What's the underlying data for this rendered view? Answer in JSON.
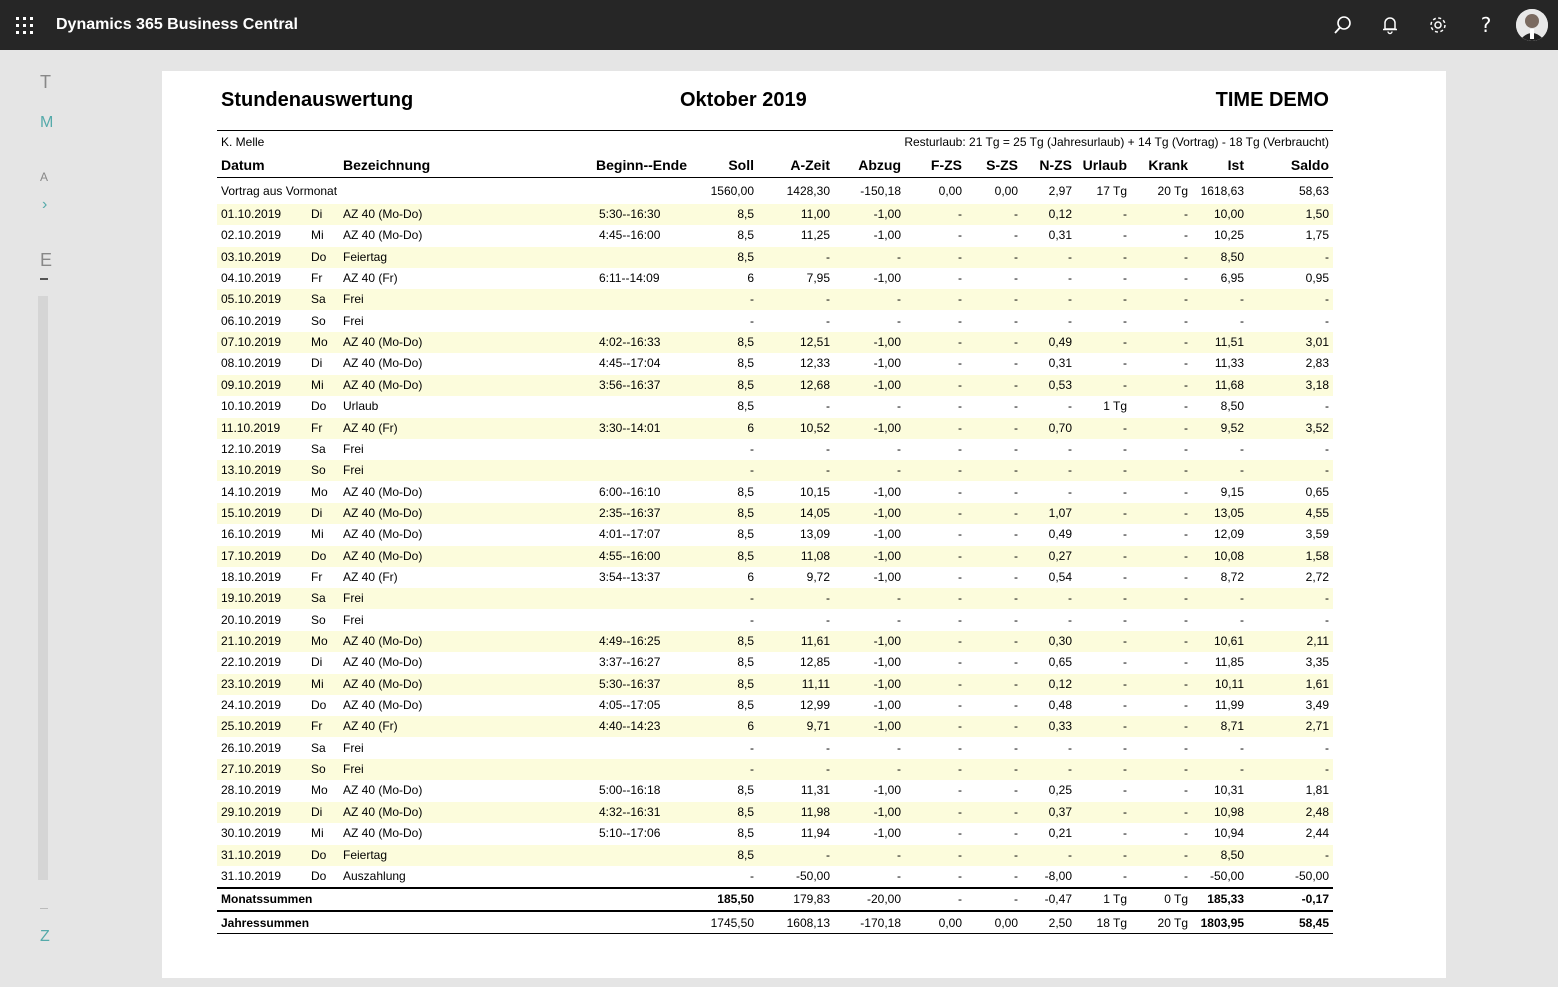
{
  "app": {
    "title": "Dynamics 365 Business Central"
  },
  "topbar_icons": [
    "waffle-icon",
    "search-icon",
    "bell-icon",
    "gear-icon",
    "help-icon",
    "avatar"
  ],
  "background_letters": {
    "t": "T",
    "m": "M",
    "a": "A",
    "arrow": "›",
    "e": "E",
    "z": "Z"
  },
  "report": {
    "title": "Stundenauswertung",
    "period": "Oktober 2019",
    "company": "TIME DEMO",
    "employee": "K. Melle",
    "vacation_note": "Resturlaub: 21 Tg = 25 Tg (Jahresurlaub) + 14 Tg (Vortrag) - 18 Tg (Verbraucht)",
    "headers": {
      "datum": "Datum",
      "bezeichnung": "Bezeichnung",
      "beginn_ende": "Beginn--Ende",
      "soll": "Soll",
      "azeit": "A-Zeit",
      "abzug": "Abzug",
      "fzs": "F-ZS",
      "szs": "S-ZS",
      "nzs": "N-ZS",
      "urlaub": "Urlaub",
      "krank": "Krank",
      "ist": "Ist",
      "saldo": "Saldo"
    },
    "carry": {
      "label": "Vortrag aus Vormonat",
      "soll": "1560,00",
      "azeit": "1428,30",
      "abzug": "-150,18",
      "fzs": "0,00",
      "szs": "0,00",
      "nzs": "2,97",
      "urlaub": "17 Tg",
      "krank": "20 Tg",
      "ist": "1618,63",
      "saldo": "58,63"
    },
    "rows": [
      [
        "01.10.2019",
        "Di",
        "AZ 40 (Mo-Do)",
        "5:30--16:30",
        "8,5",
        "11,00",
        "-1,00",
        "-",
        "-",
        "0,12",
        "-",
        "-",
        "10,00",
        "1,50"
      ],
      [
        "02.10.2019",
        "Mi",
        "AZ 40 (Mo-Do)",
        "4:45--16:00",
        "8,5",
        "11,25",
        "-1,00",
        "-",
        "-",
        "0,31",
        "-",
        "-",
        "10,25",
        "1,75"
      ],
      [
        "03.10.2019",
        "Do",
        "Feiertag",
        "",
        "8,5",
        "-",
        "-",
        "-",
        "-",
        "-",
        "-",
        "-",
        "8,50",
        "-"
      ],
      [
        "04.10.2019",
        "Fr",
        "AZ 40 (Fr)",
        "6:11--14:09",
        "6",
        "7,95",
        "-1,00",
        "-",
        "-",
        "-",
        "-",
        "-",
        "6,95",
        "0,95"
      ],
      [
        "05.10.2019",
        "Sa",
        "Frei",
        "",
        "-",
        "-",
        "-",
        "-",
        "-",
        "-",
        "-",
        "-",
        "-",
        "-"
      ],
      [
        "06.10.2019",
        "So",
        "Frei",
        "",
        "-",
        "-",
        "-",
        "-",
        "-",
        "-",
        "-",
        "-",
        "-",
        "-"
      ],
      [
        "07.10.2019",
        "Mo",
        "AZ 40 (Mo-Do)",
        "4:02--16:33",
        "8,5",
        "12,51",
        "-1,00",
        "-",
        "-",
        "0,49",
        "-",
        "-",
        "11,51",
        "3,01"
      ],
      [
        "08.10.2019",
        "Di",
        "AZ 40 (Mo-Do)",
        "4:45--17:04",
        "8,5",
        "12,33",
        "-1,00",
        "-",
        "-",
        "0,31",
        "-",
        "-",
        "11,33",
        "2,83"
      ],
      [
        "09.10.2019",
        "Mi",
        "AZ 40 (Mo-Do)",
        "3:56--16:37",
        "8,5",
        "12,68",
        "-1,00",
        "-",
        "-",
        "0,53",
        "-",
        "-",
        "11,68",
        "3,18"
      ],
      [
        "10.10.2019",
        "Do",
        "Urlaub",
        "",
        "8,5",
        "-",
        "-",
        "-",
        "-",
        "-",
        "1 Tg",
        "-",
        "8,50",
        "-"
      ],
      [
        "11.10.2019",
        "Fr",
        "AZ 40 (Fr)",
        "3:30--14:01",
        "6",
        "10,52",
        "-1,00",
        "-",
        "-",
        "0,70",
        "-",
        "-",
        "9,52",
        "3,52"
      ],
      [
        "12.10.2019",
        "Sa",
        "Frei",
        "",
        "-",
        "-",
        "-",
        "-",
        "-",
        "-",
        "-",
        "-",
        "-",
        "-"
      ],
      [
        "13.10.2019",
        "So",
        "Frei",
        "",
        "-",
        "-",
        "-",
        "-",
        "-",
        "-",
        "-",
        "-",
        "-",
        "-"
      ],
      [
        "14.10.2019",
        "Mo",
        "AZ 40 (Mo-Do)",
        "6:00--16:10",
        "8,5",
        "10,15",
        "-1,00",
        "-",
        "-",
        "-",
        "-",
        "-",
        "9,15",
        "0,65"
      ],
      [
        "15.10.2019",
        "Di",
        "AZ 40 (Mo-Do)",
        "2:35--16:37",
        "8,5",
        "14,05",
        "-1,00",
        "-",
        "-",
        "1,07",
        "-",
        "-",
        "13,05",
        "4,55"
      ],
      [
        "16.10.2019",
        "Mi",
        "AZ 40 (Mo-Do)",
        "4:01--17:07",
        "8,5",
        "13,09",
        "-1,00",
        "-",
        "-",
        "0,49",
        "-",
        "-",
        "12,09",
        "3,59"
      ],
      [
        "17.10.2019",
        "Do",
        "AZ 40 (Mo-Do)",
        "4:55--16:00",
        "8,5",
        "11,08",
        "-1,00",
        "-",
        "-",
        "0,27",
        "-",
        "-",
        "10,08",
        "1,58"
      ],
      [
        "18.10.2019",
        "Fr",
        "AZ 40 (Fr)",
        "3:54--13:37",
        "6",
        "9,72",
        "-1,00",
        "-",
        "-",
        "0,54",
        "-",
        "-",
        "8,72",
        "2,72"
      ],
      [
        "19.10.2019",
        "Sa",
        "Frei",
        "",
        "-",
        "-",
        "-",
        "-",
        "-",
        "-",
        "-",
        "-",
        "-",
        "-"
      ],
      [
        "20.10.2019",
        "So",
        "Frei",
        "",
        "-",
        "-",
        "-",
        "-",
        "-",
        "-",
        "-",
        "-",
        "-",
        "-"
      ],
      [
        "21.10.2019",
        "Mo",
        "AZ 40 (Mo-Do)",
        "4:49--16:25",
        "8,5",
        "11,61",
        "-1,00",
        "-",
        "-",
        "0,30",
        "-",
        "-",
        "10,61",
        "2,11"
      ],
      [
        "22.10.2019",
        "Di",
        "AZ 40 (Mo-Do)",
        "3:37--16:27",
        "8,5",
        "12,85",
        "-1,00",
        "-",
        "-",
        "0,65",
        "-",
        "-",
        "11,85",
        "3,35"
      ],
      [
        "23.10.2019",
        "Mi",
        "AZ 40 (Mo-Do)",
        "5:30--16:37",
        "8,5",
        "11,11",
        "-1,00",
        "-",
        "-",
        "0,12",
        "-",
        "-",
        "10,11",
        "1,61"
      ],
      [
        "24.10.2019",
        "Do",
        "AZ 40 (Mo-Do)",
        "4:05--17:05",
        "8,5",
        "12,99",
        "-1,00",
        "-",
        "-",
        "0,48",
        "-",
        "-",
        "11,99",
        "3,49"
      ],
      [
        "25.10.2019",
        "Fr",
        "AZ 40 (Fr)",
        "4:40--14:23",
        "6",
        "9,71",
        "-1,00",
        "-",
        "-",
        "0,33",
        "-",
        "-",
        "8,71",
        "2,71"
      ],
      [
        "26.10.2019",
        "Sa",
        "Frei",
        "",
        "-",
        "-",
        "-",
        "-",
        "-",
        "-",
        "-",
        "-",
        "-",
        "-"
      ],
      [
        "27.10.2019",
        "So",
        "Frei",
        "",
        "-",
        "-",
        "-",
        "-",
        "-",
        "-",
        "-",
        "-",
        "-",
        "-"
      ],
      [
        "28.10.2019",
        "Mo",
        "AZ 40 (Mo-Do)",
        "5:00--16:18",
        "8,5",
        "11,31",
        "-1,00",
        "-",
        "-",
        "0,25",
        "-",
        "-",
        "10,31",
        "1,81"
      ],
      [
        "29.10.2019",
        "Di",
        "AZ 40 (Mo-Do)",
        "4:32--16:31",
        "8,5",
        "11,98",
        "-1,00",
        "-",
        "-",
        "0,37",
        "-",
        "-",
        "10,98",
        "2,48"
      ],
      [
        "30.10.2019",
        "Mi",
        "AZ 40 (Mo-Do)",
        "5:10--17:06",
        "8,5",
        "11,94",
        "-1,00",
        "-",
        "-",
        "0,21",
        "-",
        "-",
        "10,94",
        "2,44"
      ],
      [
        "31.10.2019",
        "Do",
        "Feiertag",
        "",
        "8,5",
        "-",
        "-",
        "-",
        "-",
        "-",
        "-",
        "-",
        "8,50",
        "-"
      ],
      [
        "31.10.2019",
        "Do",
        "Auszahlung",
        "",
        "-",
        "-50,00",
        "-",
        "-",
        "-",
        "-8,00",
        "-",
        "-",
        "-50,00",
        "-50,00"
      ]
    ],
    "month_totals": {
      "label": "Monatssummen",
      "soll": "185,50",
      "azeit": "179,83",
      "abzug": "-20,00",
      "fzs": "-",
      "szs": "-",
      "nzs": "-0,47",
      "urlaub": "1 Tg",
      "krank": "0 Tg",
      "ist": "185,33",
      "saldo": "-0,17"
    },
    "year_totals": {
      "label": "Jahressummen",
      "soll": "1745,50",
      "azeit": "1608,13",
      "abzug": "-170,18",
      "fzs": "0,00",
      "szs": "0,00",
      "nzs": "2,50",
      "urlaub": "18 Tg",
      "krank": "20 Tg",
      "ist": "1803,95",
      "saldo": "58,45"
    }
  }
}
